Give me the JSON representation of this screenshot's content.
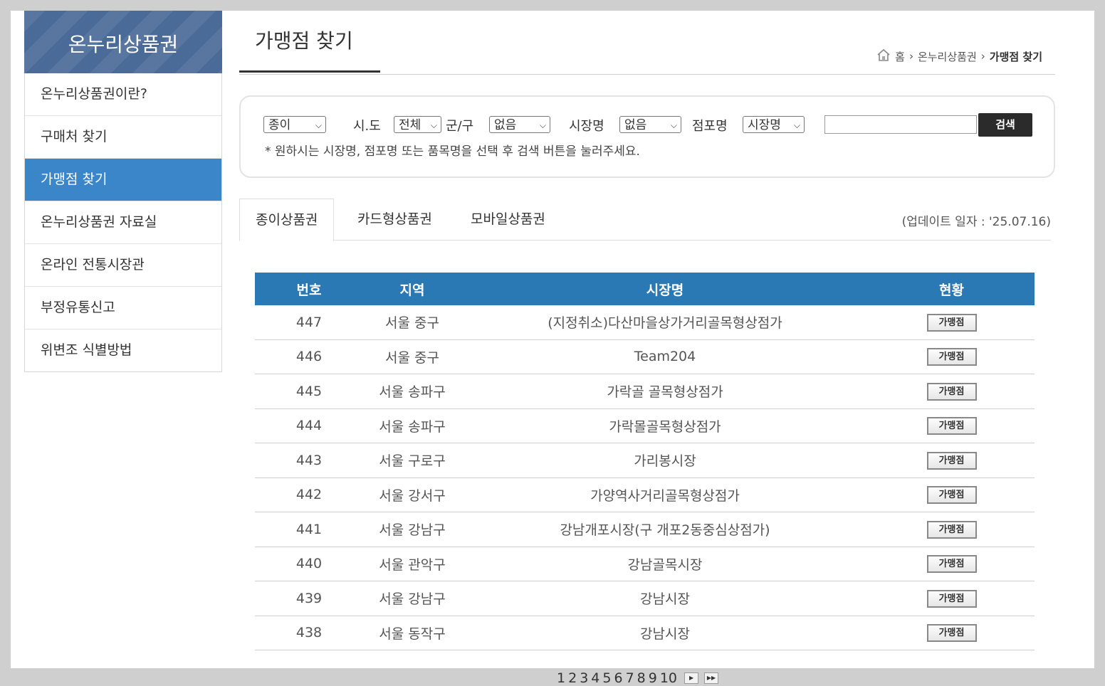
{
  "sidebar": {
    "title": "온누리상품권",
    "items": [
      {
        "label": "온누리상품권이란?"
      },
      {
        "label": "구매처 찾기"
      },
      {
        "label": "가맹점 찾기"
      },
      {
        "label": "온누리상품권 자료실"
      },
      {
        "label": "온라인 전통시장관"
      },
      {
        "label": "부정유통신고"
      },
      {
        "label": "위변조 식별방법"
      }
    ],
    "active_index": 2
  },
  "header": {
    "title": "가맹점 찾기",
    "breadcrumb": [
      "홈",
      "온누리상품권",
      "가맹점 찾기"
    ]
  },
  "search": {
    "type_value": "종이",
    "sido_label": "시.도",
    "sido_value": "전체",
    "gugun_label": "군/구",
    "gugun_value": "없음",
    "market_label": "시장명",
    "market_value": "없음",
    "store_label": "점포명",
    "store_value": "시장명",
    "query": "",
    "button": "검색",
    "hint": "* 원하시는 시장명, 점포명 또는 품목명을 선택 후 검색 버튼을 눌러주세요."
  },
  "tabs": [
    {
      "label": "종이상품권"
    },
    {
      "label": "카드형상품권"
    },
    {
      "label": "모바일상품권"
    }
  ],
  "update_text": "(업데이트 일자 : '25.07.16)",
  "table": {
    "columns": [
      "번호",
      "지역",
      "시장명",
      "현황"
    ],
    "rows": [
      {
        "no": "447",
        "region": "서울 중구",
        "market": "(지정취소)다산마을상가거리골목형상점가",
        "status": "가맹점"
      },
      {
        "no": "446",
        "region": "서울 중구",
        "market": "Team204",
        "status": "가맹점"
      },
      {
        "no": "445",
        "region": "서울 송파구",
        "market": "가락골 골목형상점가",
        "status": "가맹점"
      },
      {
        "no": "444",
        "region": "서울 송파구",
        "market": "가락몰골목형상점가",
        "status": "가맹점"
      },
      {
        "no": "443",
        "region": "서울 구로구",
        "market": "가리봉시장",
        "status": "가맹점"
      },
      {
        "no": "442",
        "region": "서울 강서구",
        "market": "가양역사거리골목형상점가",
        "status": "가맹점"
      },
      {
        "no": "441",
        "region": "서울 강남구",
        "market": "강남개포시장(구 개포2동중심상점가)",
        "status": "가맹점"
      },
      {
        "no": "440",
        "region": "서울 관악구",
        "market": "강남골목시장",
        "status": "가맹점"
      },
      {
        "no": "439",
        "region": "서울 강남구",
        "market": "강남시장",
        "status": "가맹점"
      },
      {
        "no": "438",
        "region": "서울 동작구",
        "market": "강남시장",
        "status": "가맹점"
      }
    ]
  },
  "pagination": {
    "pages": [
      "1",
      "2",
      "3",
      "4",
      "5",
      "6",
      "7",
      "8",
      "9",
      "10"
    ],
    "next_icon": "next-page-icon",
    "last_icon": "last-page-icon"
  }
}
